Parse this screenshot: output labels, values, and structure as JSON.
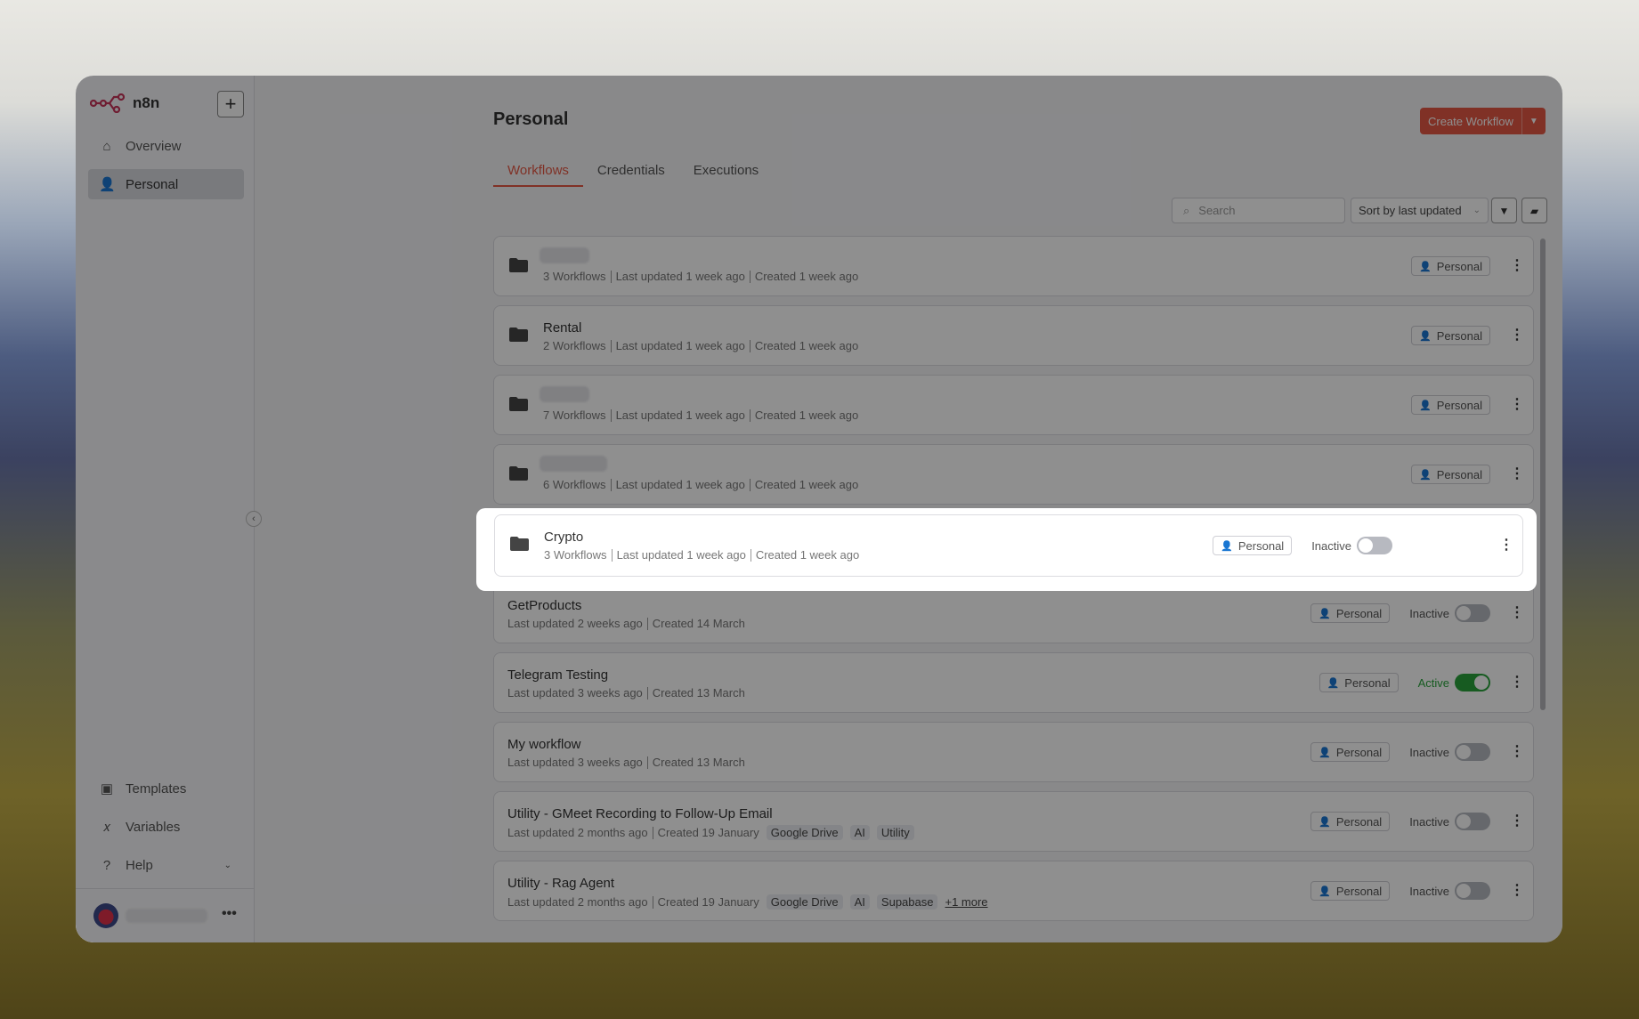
{
  "app": {
    "name": "n8n",
    "new_label": "+"
  },
  "sidebar": {
    "items": [
      {
        "label": "Overview",
        "icon": "home-icon"
      },
      {
        "label": "Personal",
        "icon": "user-icon"
      }
    ],
    "bottom": [
      {
        "label": "Templates",
        "icon": "box-icon"
      },
      {
        "label": "Variables",
        "icon": "variable-icon"
      },
      {
        "label": "Help",
        "icon": "question-icon"
      }
    ],
    "user_menu": "•••"
  },
  "header": {
    "title": "Personal",
    "create_label": "Create Workflow"
  },
  "tabs": [
    "Workflows",
    "Credentials",
    "Executions"
  ],
  "toolbar": {
    "search_placeholder": "Search",
    "sort": "Sort by last updated"
  },
  "colors": {
    "accent": "#e45844",
    "active": "#29a33b"
  },
  "rows": [
    {
      "type": "folder",
      "name": "",
      "blurred": true,
      "meta": [
        "3 Workflows",
        "Last updated 1 week ago",
        "Created 1 week ago"
      ],
      "owner": "Personal"
    },
    {
      "type": "folder",
      "name": "Rental",
      "meta": [
        "2 Workflows",
        "Last updated 1 week ago",
        "Created 1 week ago"
      ],
      "owner": "Personal"
    },
    {
      "type": "folder",
      "name": "",
      "blurred": true,
      "meta": [
        "7 Workflows",
        "Last updated 1 week ago",
        "Created 1 week ago"
      ],
      "owner": "Personal"
    },
    {
      "type": "folder",
      "name": "",
      "blurred": true,
      "meta": [
        "6 Workflows",
        "Last updated 1 week ago",
        "Created 1 week ago"
      ],
      "owner": "Personal"
    },
    {
      "type": "folder",
      "name": "Crypto",
      "meta": [
        "3 Workflows",
        "Last updated 1 week ago",
        "Created 1 week ago"
      ],
      "owner": "Personal",
      "status": "Inactive",
      "highlighted": true
    },
    {
      "type": "workflow",
      "name": "GetProducts",
      "meta": [
        "Last updated 2 weeks ago",
        "Created 14 March"
      ],
      "owner": "Personal",
      "status": "Inactive"
    },
    {
      "type": "workflow",
      "name": "Telegram Testing",
      "meta": [
        "Last updated 3 weeks ago",
        "Created 13 March"
      ],
      "owner": "Personal",
      "status": "Active"
    },
    {
      "type": "workflow",
      "name": "My workflow",
      "meta": [
        "Last updated 3 weeks ago",
        "Created 13 March"
      ],
      "owner": "Personal",
      "status": "Inactive"
    },
    {
      "type": "workflow",
      "name": "Utility - GMeet Recording to Follow-Up Email",
      "meta": [
        "Last updated 2 months ago",
        "Created 19 January"
      ],
      "tags": [
        "Google Drive",
        "AI",
        "Utility"
      ],
      "owner": "Personal",
      "status": "Inactive"
    },
    {
      "type": "workflow",
      "name": "Utility - Rag Agent",
      "meta": [
        "Last updated 2 months ago",
        "Created 19 January"
      ],
      "tags": [
        "Google Drive",
        "AI",
        "Supabase"
      ],
      "more": "+1 more",
      "owner": "Personal",
      "status": "Inactive"
    }
  ]
}
